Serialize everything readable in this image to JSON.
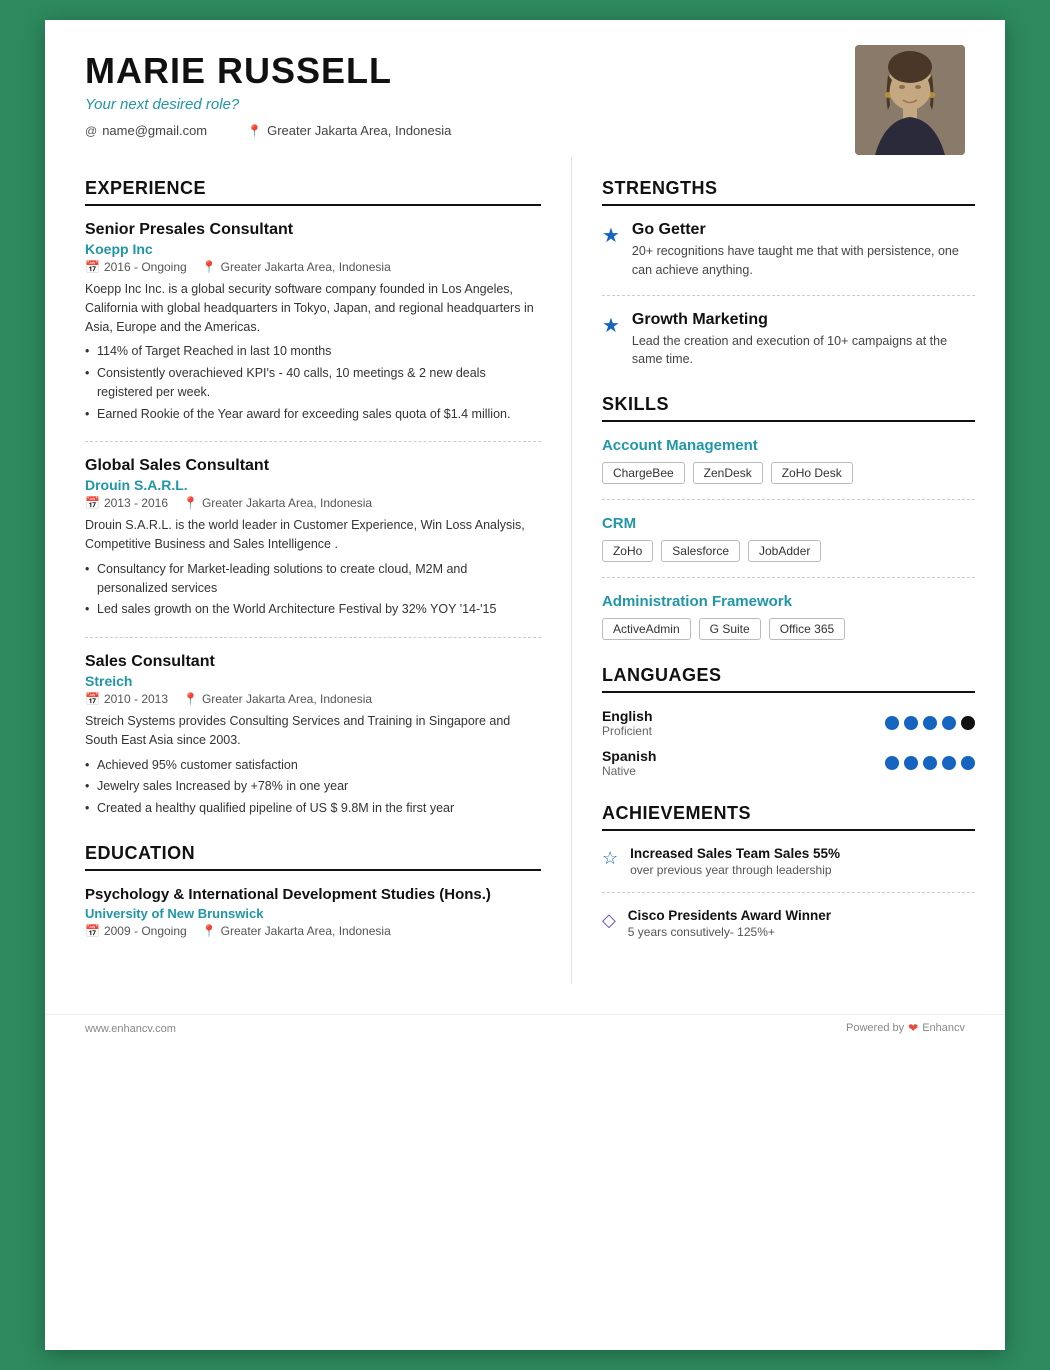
{
  "header": {
    "name": "MARIE RUSSELL",
    "tagline": "Your next desired role?",
    "email": "name@gmail.com",
    "location": "Greater Jakarta Area, Indonesia"
  },
  "experience": {
    "section_title": "EXPERIENCE",
    "jobs": [
      {
        "title": "Senior Presales Consultant",
        "company": "Koepp Inc",
        "period": "2016 - Ongoing",
        "location": "Greater Jakarta Area, Indonesia",
        "description": "Koepp Inc Inc. is a global security software company founded in Los Angeles, California with global headquarters in Tokyo, Japan, and regional headquarters in Asia, Europe and the Americas.",
        "bullets": [
          "114% of Target Reached in last 10 months",
          "Consistently overachieved KPI's - 40 calls, 10 meetings & 2 new deals registered per week.",
          "Earned Rookie of the Year award for exceeding sales quota of $1.4 million."
        ]
      },
      {
        "title": "Global Sales Consultant",
        "company": "Drouin S.A.R.L.",
        "period": "2013 - 2016",
        "location": "Greater Jakarta Area, Indonesia",
        "description": "Drouin S.A.R.L. is the world leader in Customer Experience, Win Loss Analysis, Competitive Business and Sales Intelligence .",
        "bullets": [
          "Consultancy for Market-leading solutions to create cloud, M2M and personalized services",
          "Led sales growth on the World Architecture Festival by 32% YOY '14-'15"
        ]
      },
      {
        "title": "Sales Consultant",
        "company": "Streich",
        "period": "2010 - 2013",
        "location": "Greater Jakarta Area, Indonesia",
        "description": "Streich Systems provides Consulting Services and Training in Singapore and South East Asia since 2003.",
        "bullets": [
          "Achieved 95% customer satisfaction",
          "Jewelry sales Increased by +78% in one year",
          "Created a healthy qualified pipeline of US $ 9.8M in the first year"
        ]
      }
    ]
  },
  "education": {
    "section_title": "EDUCATION",
    "items": [
      {
        "degree": "Psychology & International Development Studies (Hons.)",
        "school": "University of New Brunswick",
        "period": "2009 - Ongoing",
        "location": "Greater Jakarta Area, Indonesia"
      }
    ]
  },
  "strengths": {
    "section_title": "STRENGTHS",
    "items": [
      {
        "title": "Go Getter",
        "description": "20+ recognitions have taught me that with persistence, one can achieve anything."
      },
      {
        "title": "Growth Marketing",
        "description": "Lead the creation and execution of 10+ campaigns at the same time."
      }
    ]
  },
  "skills": {
    "section_title": "SKILLS",
    "categories": [
      {
        "name": "Account Management",
        "tags": [
          "ChargeBee",
          "ZenDesk",
          "ZoHo Desk"
        ]
      },
      {
        "name": "CRM",
        "tags": [
          "ZoHo",
          "Salesforce",
          "JobAdder"
        ]
      },
      {
        "name": "Administration Framework",
        "tags": [
          "ActiveAdmin",
          "G Suite",
          "Office 365"
        ]
      }
    ]
  },
  "languages": {
    "section_title": "LANGUAGES",
    "items": [
      {
        "name": "English",
        "level": "Proficient",
        "filled_dots": 4,
        "empty_dots": 1
      },
      {
        "name": "Spanish",
        "level": "Native",
        "filled_dots": 5,
        "empty_dots": 0
      }
    ]
  },
  "achievements": {
    "section_title": "ACHIEVEMENTS",
    "items": [
      {
        "title": "Increased Sales Team Sales 55%",
        "description": "over previous year through leadership",
        "icon": "☆"
      },
      {
        "title": "Cisco Presidents Award Winner",
        "description": "5 years consutively- 125%+",
        "icon": "◇"
      }
    ]
  },
  "footer": {
    "website": "www.enhancv.com",
    "powered_by": "Powered by",
    "brand": "Enhancv"
  }
}
